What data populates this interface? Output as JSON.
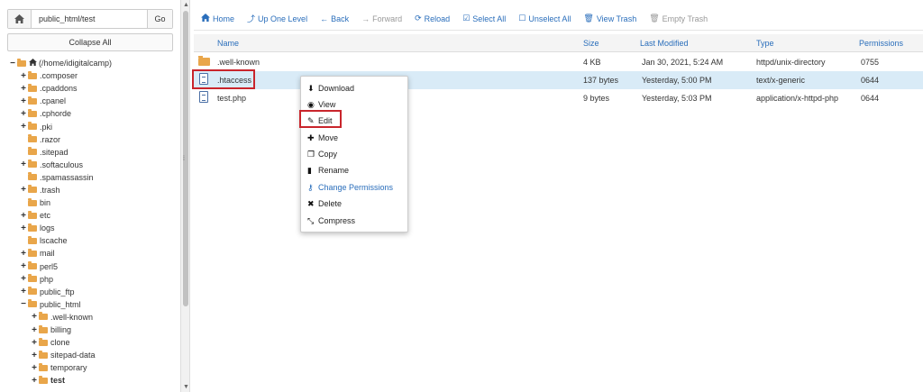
{
  "sidebar": {
    "path_value": "public_html/test",
    "go_label": "Go",
    "collapse_label": "Collapse All",
    "tree": [
      {
        "label": "(/home/idigitalcamp)",
        "toggle": "−",
        "indent": 0,
        "home": true
      },
      {
        "label": ".composer",
        "toggle": "+",
        "indent": 1
      },
      {
        "label": ".cpaddons",
        "toggle": "+",
        "indent": 1
      },
      {
        "label": ".cpanel",
        "toggle": "+",
        "indent": 1
      },
      {
        "label": ".cphorde",
        "toggle": "+",
        "indent": 1
      },
      {
        "label": ".pki",
        "toggle": "+",
        "indent": 1
      },
      {
        "label": ".razor",
        "toggle": "",
        "indent": 1
      },
      {
        "label": ".sitepad",
        "toggle": "",
        "indent": 1
      },
      {
        "label": ".softaculous",
        "toggle": "+",
        "indent": 1
      },
      {
        "label": ".spamassassin",
        "toggle": "",
        "indent": 1
      },
      {
        "label": ".trash",
        "toggle": "+",
        "indent": 1
      },
      {
        "label": "bin",
        "toggle": "",
        "indent": 1
      },
      {
        "label": "etc",
        "toggle": "+",
        "indent": 1
      },
      {
        "label": "logs",
        "toggle": "+",
        "indent": 1
      },
      {
        "label": "lscache",
        "toggle": "",
        "indent": 1
      },
      {
        "label": "mail",
        "toggle": "+",
        "indent": 1
      },
      {
        "label": "perl5",
        "toggle": "+",
        "indent": 1
      },
      {
        "label": "php",
        "toggle": "+",
        "indent": 1
      },
      {
        "label": "public_ftp",
        "toggle": "+",
        "indent": 1
      },
      {
        "label": "public_html",
        "toggle": "−",
        "indent": 1
      },
      {
        "label": ".well-known",
        "toggle": "+",
        "indent": 2
      },
      {
        "label": "billing",
        "toggle": "+",
        "indent": 2
      },
      {
        "label": "clone",
        "toggle": "+",
        "indent": 2
      },
      {
        "label": "sitepad-data",
        "toggle": "+",
        "indent": 2
      },
      {
        "label": "temporary",
        "toggle": "+",
        "indent": 2
      },
      {
        "label": "test",
        "toggle": "+",
        "indent": 2,
        "bold": true
      }
    ]
  },
  "toolbar": {
    "home": "Home",
    "up": "Up One Level",
    "back": "Back",
    "forward": "Forward",
    "reload": "Reload",
    "select_all": "Select All",
    "unselect_all": "Unselect All",
    "view_trash": "View Trash",
    "empty_trash": "Empty Trash"
  },
  "table": {
    "headers": {
      "name": "Name",
      "size": "Size",
      "modified": "Last Modified",
      "type": "Type",
      "permissions": "Permissions"
    },
    "rows": [
      {
        "name": ".well-known",
        "size": "4 KB",
        "modified": "Jan 30, 2021, 5:24 AM",
        "type": "httpd/unix-directory",
        "perm": "0755",
        "kind": "folder"
      },
      {
        "name": ".htaccess",
        "size": "137 bytes",
        "modified": "Yesterday, 5:00 PM",
        "type": "text/x-generic",
        "perm": "0644",
        "kind": "file"
      },
      {
        "name": "test.php",
        "size": "9 bytes",
        "modified": "Yesterday, 5:03 PM",
        "type": "application/x-httpd-php",
        "perm": "0644",
        "kind": "file"
      }
    ]
  },
  "context_menu": {
    "download": "Download",
    "view": "View",
    "edit": "Edit",
    "move": "Move",
    "copy": "Copy",
    "rename": "Rename",
    "change_permissions": "Change Permissions",
    "delete": "Delete",
    "compress": "Compress"
  },
  "colors": {
    "accent": "#2a6ebb",
    "selected_row": "#d9ebf7",
    "highlight_box": "#c9252c",
    "folder": "#e9a64a"
  }
}
